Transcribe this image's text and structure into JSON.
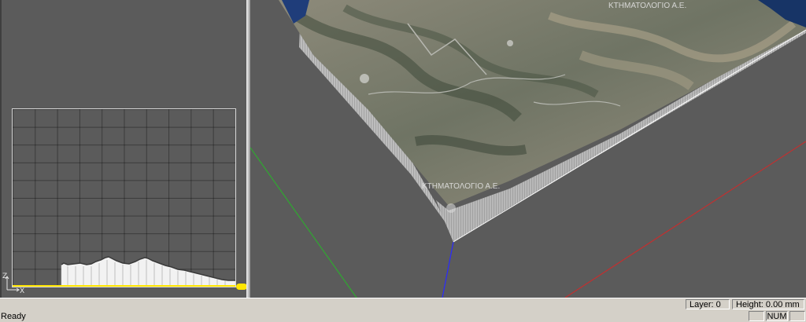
{
  "profile_view": {
    "axis_z": "Z",
    "axis_x": "X",
    "colors": {
      "grid": "#3a3a3a",
      "frame": "#d8d8d8",
      "profile_fill": "#f2f2f2",
      "baseline": "#ffe600"
    }
  },
  "viewport": {
    "colors": {
      "x_axis": "#c03030",
      "y_axis": "#2fa830",
      "z_axis": "#2a2aff"
    },
    "terrain_labels": [
      "ΚΤΗΜΑΤΟΛΟΓΙΟ Α.Ε.",
      "ΚΤΗΜΑΤΟΛΟΓΙΟ Α.Ε."
    ]
  },
  "statusbar": {
    "message": "Ready",
    "layer": "Layer: 0",
    "height": "Height: 0.00 mm",
    "num": "NUM"
  }
}
